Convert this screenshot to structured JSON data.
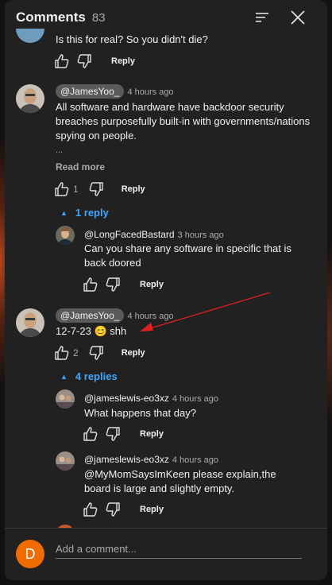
{
  "header": {
    "title": "Comments",
    "count": "83"
  },
  "comments": [
    {
      "text": "Is this for real? So you didn't die?",
      "reply_label": "Reply"
    },
    {
      "handle": "@JamesYoo_",
      "time": "4 hours ago",
      "text": "All software and hardware have backdoor security breaches  purposefully built-in with governments/nations spying on people.",
      "ellipsis": "...",
      "read_more": "Read more",
      "likes": "1",
      "reply_label": "Reply",
      "replies_toggle": "1 reply",
      "replies": [
        {
          "handle": "@LongFacedBastard",
          "time": "3 hours ago",
          "text": "Can you share any software in specific that is back doored",
          "reply_label": "Reply"
        }
      ]
    },
    {
      "handle": "@JamesYoo_",
      "time": "4 hours ago",
      "text_before": "12-7-23",
      "emoji": "😊",
      "text_after": "shh",
      "likes": "2",
      "reply_label": "Reply",
      "replies_toggle": "4 replies",
      "replies": [
        {
          "handle": "@jameslewis-eo3xz",
          "time": "4 hours ago",
          "text": "What happens that day?",
          "reply_label": "Reply"
        },
        {
          "handle": "@jameslewis-eo3xz",
          "time": "4 hours ago",
          "mention": "@MyMomSaysImKeen",
          "text": "please explain,the board is large and slightly empty.",
          "reply_label": "Reply"
        }
      ]
    }
  ],
  "footer": {
    "avatar_letter": "D",
    "placeholder": "Add a comment..."
  },
  "colors": {
    "panel": "#212121",
    "link_blue": "#3ea6ff",
    "user_avatar": "#ef6c00",
    "annotation_arrow": "#e02020"
  },
  "icons": [
    "sort-icon",
    "close-icon",
    "thumb-up-icon",
    "thumb-down-icon",
    "caret-up-icon"
  ]
}
